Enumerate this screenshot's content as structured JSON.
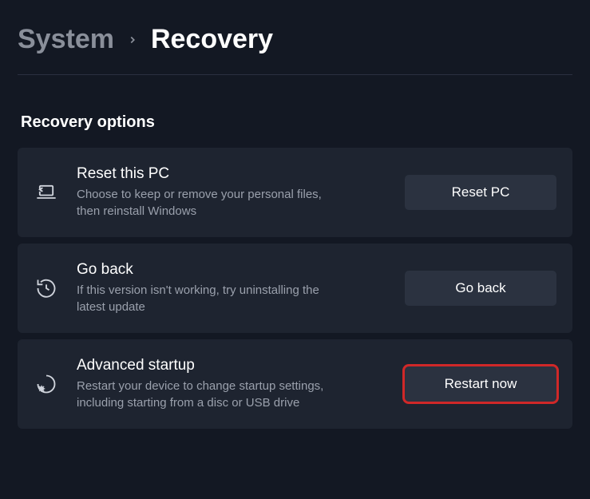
{
  "breadcrumb": {
    "parent": "System",
    "current": "Recovery"
  },
  "section_title": "Recovery options",
  "options": [
    {
      "icon": "reset-pc-icon",
      "title": "Reset this PC",
      "desc": "Choose to keep or remove your personal files, then reinstall Windows",
      "button": "Reset PC",
      "highlighted": false
    },
    {
      "icon": "go-back-icon",
      "title": "Go back",
      "desc": "If this version isn't working, try uninstalling the latest update",
      "button": "Go back",
      "highlighted": false
    },
    {
      "icon": "advanced-startup-icon",
      "title": "Advanced startup",
      "desc": "Restart your device to change startup settings, including starting from a disc or USB drive",
      "button": "Restart now",
      "highlighted": true
    }
  ]
}
